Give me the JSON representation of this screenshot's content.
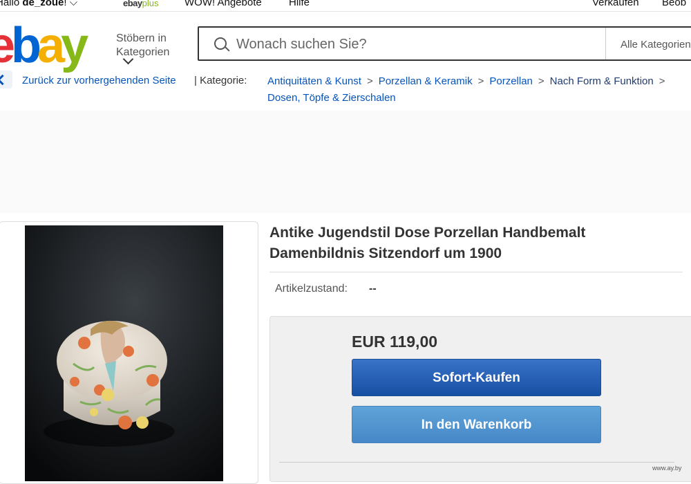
{
  "topbar": {
    "greet_prefix": "Hallo ",
    "user": "de_zoue",
    "greet_suffix": "!",
    "ebay_plus_ebay": "ebay",
    "ebay_plus_plus": "plus",
    "deals": "WOW! Angebote",
    "help": "Hilfe",
    "sell": "Verkaufen",
    "watch": "Beob"
  },
  "header": {
    "logo": [
      "e",
      "b",
      "a",
      "y"
    ],
    "browse": "Stöbern in Kategorien",
    "search_placeholder": "Wonach suchen Sie?",
    "category_select": "Alle Kategorien"
  },
  "breadcrumb": {
    "back": "Zurück zur vorhergehenden Seite",
    "category_label": "| Kategorie:",
    "items": [
      "Antiquitäten & Kunst",
      "Porzellan & Keramik",
      "Porzellan",
      "Nach Form & Funktion",
      "Dosen, Töpfe & Zierschalen"
    ]
  },
  "item": {
    "title": "Antike Jugendstil Dose Porzellan Handbemalt Damenbildnis Sitzendorf um 1900",
    "condition_label": "Artikelzustand:",
    "condition_value": "--",
    "price": "EUR 119,00",
    "buy_now": "Sofort-Kaufen",
    "add_to_cart": "In den Warenkorb"
  },
  "watermark": "www.ay.by",
  "colors": {
    "link": "#0654ba",
    "buy_now": "#174fa3",
    "cart": "#4688c8",
    "logo_e": "#e53238",
    "logo_b": "#0064d2",
    "logo_a": "#f5af02",
    "logo_y": "#86b817"
  }
}
